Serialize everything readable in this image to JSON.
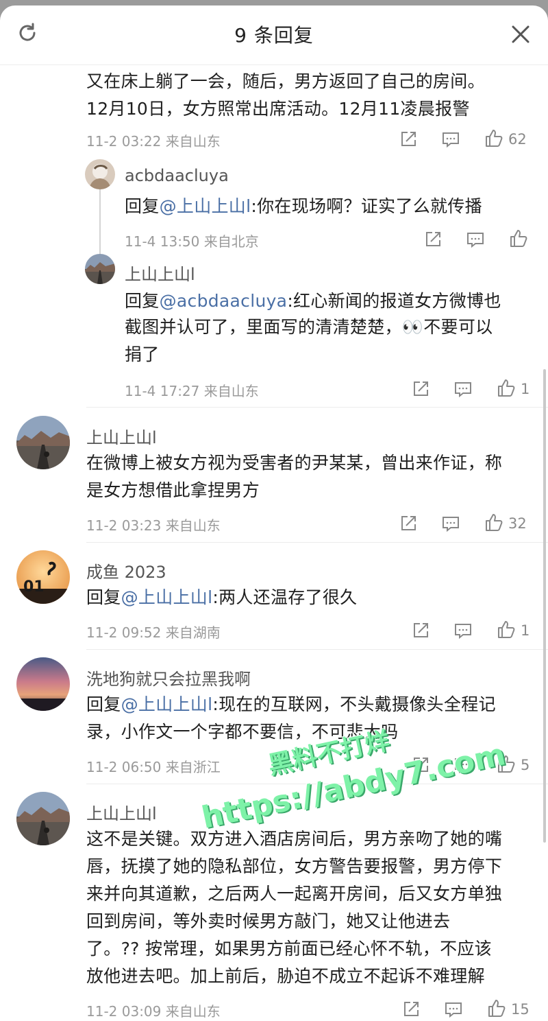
{
  "header": {
    "title": "9 条回复",
    "refresh_icon": "refresh-icon",
    "close_icon": "close-icon"
  },
  "comments": [
    {
      "text_line1": "又在床上躺了一会，随后，男方返回了自己的房间。",
      "text_line2": "12月10日，女方照常出席活动。12月11凌晨报警",
      "meta": "11-2 03:22 来自山东",
      "likes": "62"
    },
    {
      "user": "acbdaacluya",
      "reply_prefix": "回复",
      "mention": "@上山上山l",
      "text": ":你在现场啊？证实了么就传播",
      "meta": "11-4 13:50 来自北京",
      "likes": ""
    },
    {
      "user": "上山上山l",
      "reply_prefix": "回复",
      "mention": "@acbdaacluya",
      "text_line1": ":红心新闻的报道女方微博也",
      "text_line2": "截图并认可了，里面写的清清楚楚，",
      "emoji": "👀",
      "text_line2_end": "不要可以",
      "text_line3": "捐了",
      "meta": "11-4 17:27 来自山东",
      "likes": "1"
    },
    {
      "user": "上山上山l",
      "text_line1": "在微博上被女方视为受害者的尹某某，曾出来作证，称",
      "text_line2": "是女方想借此拿捏男方",
      "meta": "11-2 03:23 来自山东",
      "likes": "32"
    },
    {
      "user": "成鱼 2023",
      "reply_prefix": "回复",
      "mention": "@上山上山l",
      "text": ":两人还温存了很久",
      "meta": "11-2 09:52 来自湖南",
      "likes": "1",
      "avatar_text": "01"
    },
    {
      "user": "洗地狗就只会拉黑我啊",
      "reply_prefix": "回复",
      "mention": "@上山上山l",
      "text_line1": ":现在的互联网，不头戴摄像头全程记",
      "text_line2": "录，小作文一个字都不要信，不可悲大吗",
      "meta": "11-2 06:50 来自浙江",
      "likes": "5"
    },
    {
      "user": "上山上山l",
      "lines": [
        "这不是关键。双方进入酒店房间后，男方亲吻了她的嘴",
        "唇，抚摸了她的隐私部位，女方警告要报警，男方停下",
        "来并向其道歉，之后两人一起离开房间，后又女方单独",
        "回到房间，等外卖时候男方敲门，她又让他进去",
        "了。?? 按常理，如果男方前面已经心怀不轨，不应该",
        "放他进去吧。加上前后，胁迫不成立不起诉不难理解"
      ],
      "meta": "11-2 03:09 来自山东",
      "likes": "15"
    }
  ],
  "watermark": {
    "line1": "黑料不打烊",
    "line2": "https://abdy7.com"
  },
  "icons": {
    "share": "share-icon",
    "comment": "comment-icon",
    "like": "thumbs-up-icon"
  },
  "colors": {
    "mention": "#4a6fa5",
    "meta": "#9a9a9a",
    "watermark": "#7ef2a8"
  }
}
